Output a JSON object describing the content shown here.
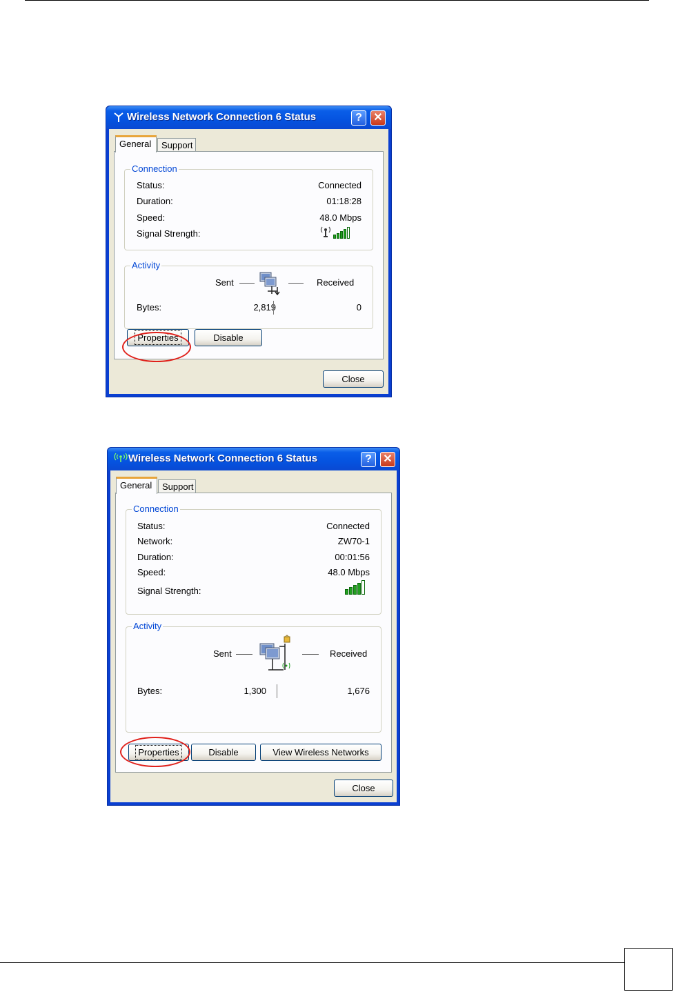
{
  "dialogs": [
    {
      "title": "Wireless Network Connection 6 Status",
      "tabs": [
        "General",
        "Support"
      ],
      "connection_legend": "Connection",
      "rows": [
        {
          "label": "Status:",
          "value": "Connected"
        },
        {
          "label": "Duration:",
          "value": "01:18:28"
        },
        {
          "label": "Speed:",
          "value": "48.0 Mbps"
        },
        {
          "label": "Signal Strength:",
          "value": ""
        }
      ],
      "signal_bars_filled": 4,
      "signal_bars_total": 5,
      "activity_legend": "Activity",
      "sent_label": "Sent",
      "received_label": "Received",
      "bytes_label": "Bytes:",
      "bytes_sent": "2,819",
      "bytes_received": "0",
      "buttons": {
        "properties": "Properties",
        "disable": "Disable",
        "close": "Close"
      }
    },
    {
      "title": "Wireless Network Connection 6 Status",
      "tabs": [
        "General",
        "Support"
      ],
      "connection_legend": "Connection",
      "rows": [
        {
          "label": "Status:",
          "value": "Connected"
        },
        {
          "label": "Network:",
          "value": "ZW70-1"
        },
        {
          "label": "Duration:",
          "value": "00:01:56"
        },
        {
          "label": "Speed:",
          "value": "48.0 Mbps"
        },
        {
          "label": "Signal Strength:",
          "value": ""
        }
      ],
      "signal_bars_filled": 4,
      "signal_bars_total": 5,
      "activity_legend": "Activity",
      "sent_label": "Sent",
      "received_label": "Received",
      "bytes_label": "Bytes:",
      "bytes_sent": "1,300",
      "bytes_received": "1,676",
      "buttons": {
        "properties": "Properties",
        "disable": "Disable",
        "view_wireless": "View Wireless Networks",
        "close": "Close"
      }
    }
  ],
  "colors": {
    "titlebar": "#0553e0",
    "client": "#ece9d8",
    "legend": "#0046d5",
    "highlight": "#e0201a",
    "signal": "#22a020"
  },
  "icons": [
    "antenna-icon",
    "wireless-icon",
    "help-icon",
    "close-icon",
    "network-computers-icon",
    "signal-bars-icon"
  ]
}
